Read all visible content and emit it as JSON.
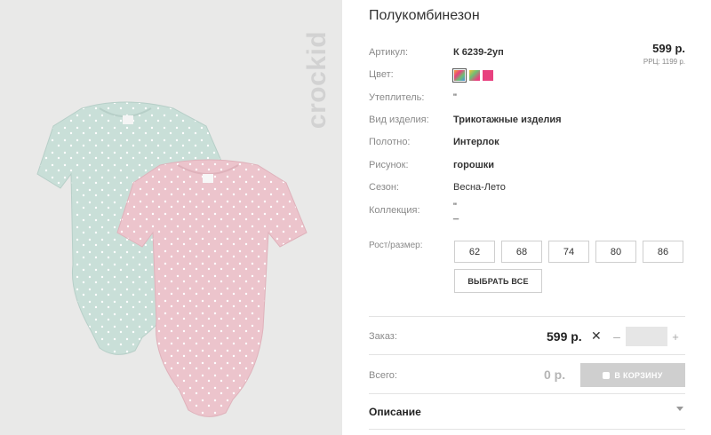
{
  "product": {
    "title": "Полукомбинезон",
    "brand": "crockid",
    "price": "599 р.",
    "rrp": "РРЦ: 1199 р."
  },
  "attributes": [
    {
      "label": "Артикул:",
      "value": "К 6239-2уп",
      "bold": true
    },
    {
      "label": "Цвет:",
      "value": ""
    },
    {
      "label": "Утеплитель:",
      "value": "\""
    },
    {
      "label": "Вид изделия:",
      "value": "Трикотажные изделия",
      "bold": true
    },
    {
      "label": "Полотно:",
      "value": "Интерлок",
      "bold": true
    },
    {
      "label": "Рисунок:",
      "value": "горошки",
      "bold": true
    },
    {
      "label": "Сезон:",
      "value": "Весна-Лето"
    },
    {
      "label": "Коллекция:",
      "value": "\"\n_"
    }
  ],
  "colors": [
    {
      "name": "multicolor-1",
      "hex": "#f2a33a",
      "active": true
    },
    {
      "name": "multicolor-2",
      "hex": "#6fbf73"
    },
    {
      "name": "pink",
      "hex": "#e8417f"
    }
  ],
  "sizes": {
    "label": "Рост/размер:",
    "options": [
      "62",
      "68",
      "74",
      "80",
      "86"
    ],
    "select_all": "ВЫБРАТЬ ВСЕ"
  },
  "order": {
    "label": "Заказ:",
    "price": "599 р.",
    "times": "✕",
    "minus": "–",
    "plus": "+",
    "quantity": ""
  },
  "total": {
    "label": "Всего:",
    "value": "0 р.",
    "cart_button": "В КОРЗИНУ"
  },
  "description": {
    "label": "Описание"
  }
}
